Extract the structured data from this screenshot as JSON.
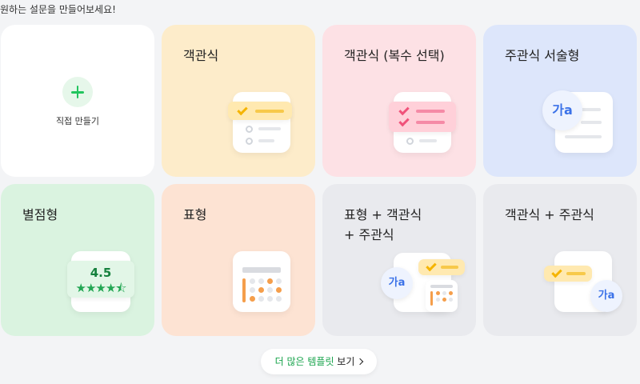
{
  "headline": "원하는 설문을 만들어보세요!",
  "create": {
    "label": "직접 만들기"
  },
  "cards": {
    "mc": "객관식",
    "multi": "객관식 (복수 선택)",
    "text": "주관식 서술형",
    "star": "별점형",
    "table": "표형",
    "tablemc": "표형 + 객관식\n+ 주관식",
    "mctext": "객관식 + 주관식"
  },
  "icons": {
    "ga_text": "가a",
    "rating_value": "4.5",
    "rating_stars": "★★★★⯪"
  },
  "more": {
    "prefix": "더 많은 ",
    "highlight": "템플릿",
    "suffix": " 보기"
  },
  "colors": {
    "green": "#22c55e",
    "yellow_check": "#f5b400",
    "pink_check": "#f0527a",
    "blue_text": "#3b72e8",
    "orange": "#f59e4b"
  }
}
